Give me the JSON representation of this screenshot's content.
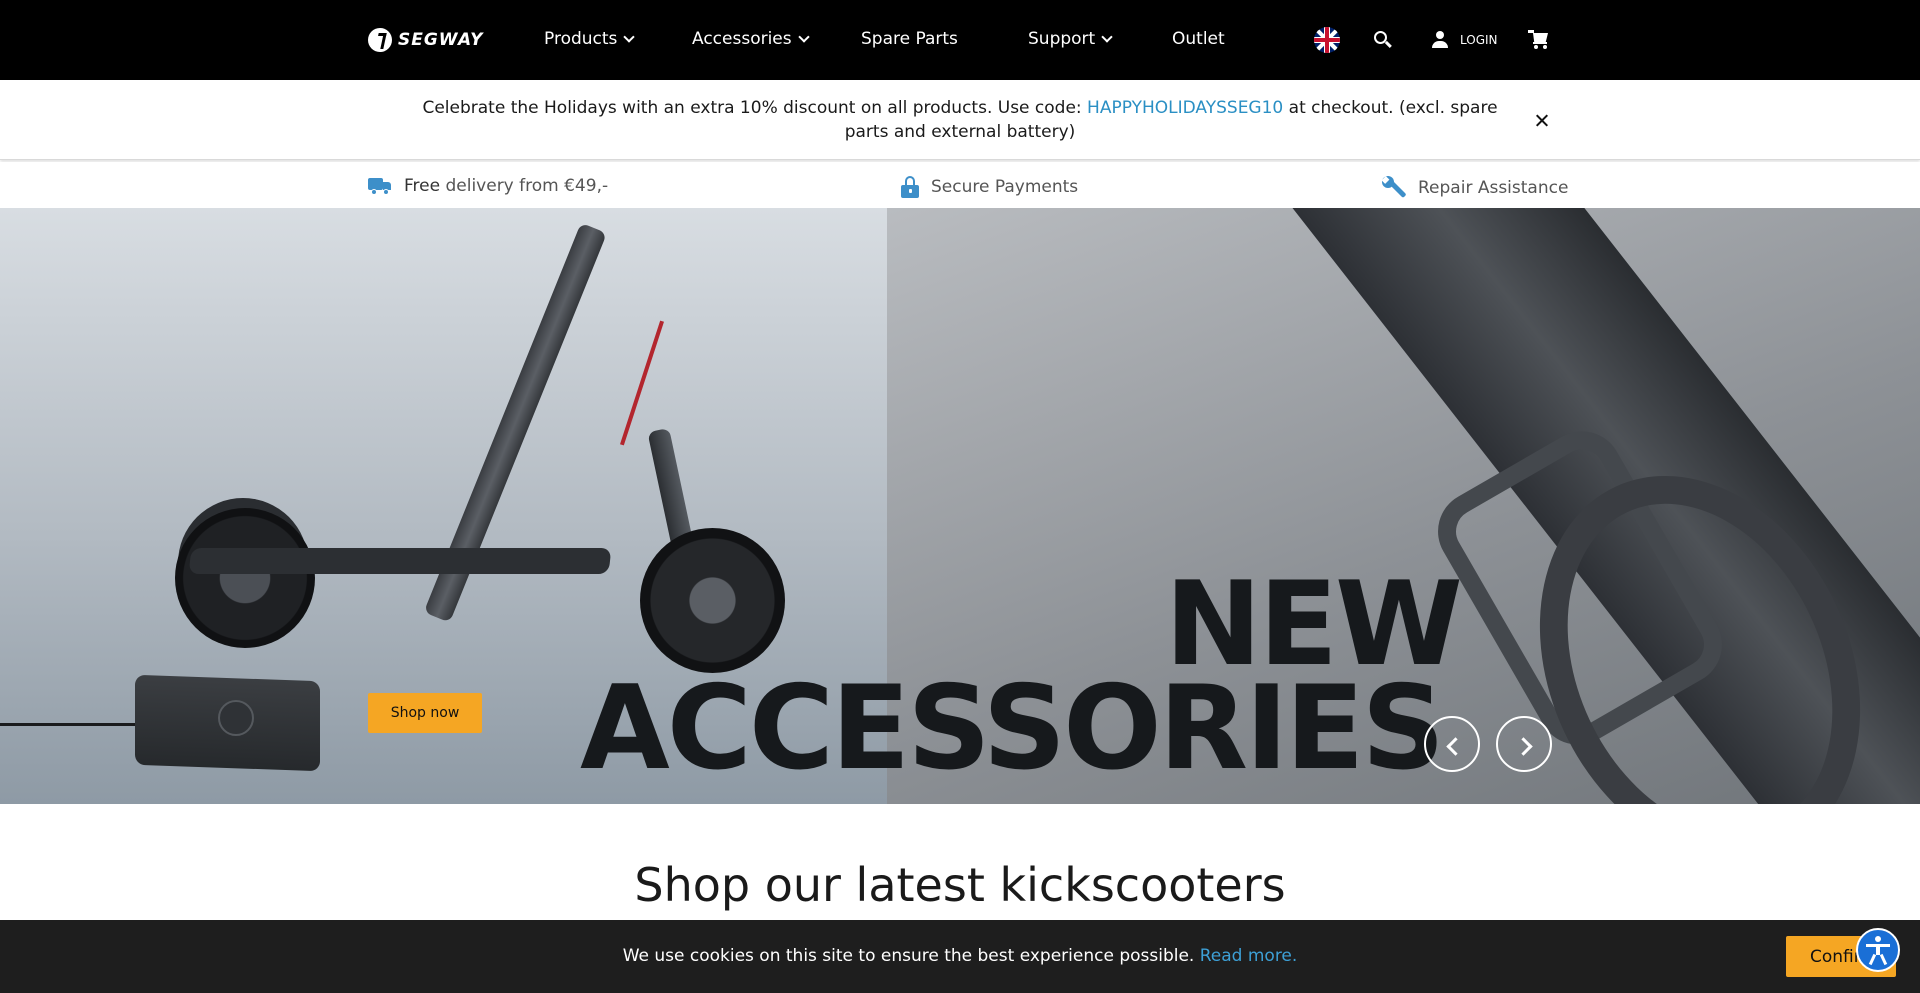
{
  "header": {
    "logo_text": "SEGWAY",
    "nav": [
      {
        "label": "Products",
        "has_dropdown": true
      },
      {
        "label": "Accessories",
        "has_dropdown": true
      },
      {
        "label": "Spare Parts",
        "has_dropdown": false
      },
      {
        "label": "Support",
        "has_dropdown": true
      },
      {
        "label": "Outlet",
        "has_dropdown": false
      }
    ],
    "language_icon": "uk-flag-icon",
    "login_label": "LOGIN"
  },
  "promo": {
    "text_before": "Celebrate the Holidays with an extra 10% discount on all products. Use code: ",
    "code": "HAPPYHOLIDAYSSEG10",
    "text_after": " at checkout. (excl. spare parts and external battery)"
  },
  "usp": [
    {
      "icon": "truck-icon",
      "strong": "Free",
      "text": " delivery from €49,-"
    },
    {
      "icon": "lock-icon",
      "strong": "",
      "text": "Secure Payments"
    },
    {
      "icon": "wrench-icon",
      "strong": "",
      "text": "Repair Assistance"
    }
  ],
  "hero": {
    "title_line1": "NEW",
    "title_line2": "ACCESSORIES",
    "cta_label": "Shop now"
  },
  "section": {
    "title": "Shop our latest kickscooters"
  },
  "cookie": {
    "text": "We use cookies on this site to ensure the best experience possible. ",
    "link": "Read more.",
    "confirm_label": "Confirm"
  },
  "colors": {
    "accent": "#f5a623",
    "link": "#2a8fc4",
    "icon_blue": "#3d8fc9",
    "header_bg": "#000000"
  }
}
